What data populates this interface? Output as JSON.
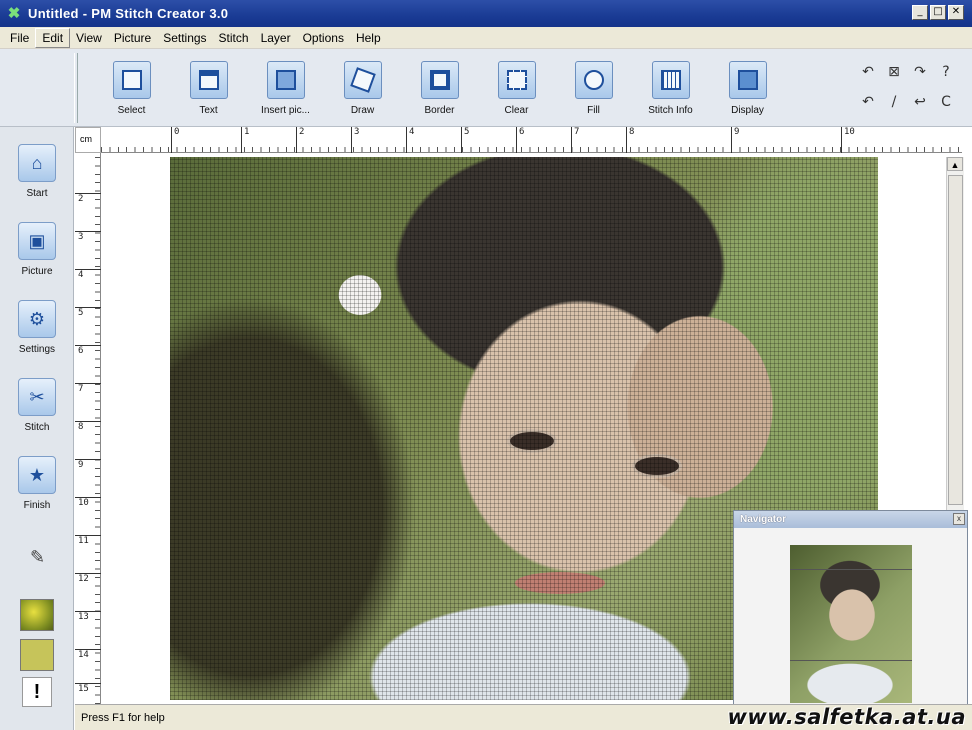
{
  "window": {
    "title": "Untitled - PM Stitch Creator 3.0",
    "controls": [
      "_",
      "□",
      "✕"
    ]
  },
  "menu": [
    "File",
    "Edit",
    "View",
    "Picture",
    "Settings",
    "Stitch",
    "Layer",
    "Options",
    "Help"
  ],
  "toolbar": {
    "tools": [
      {
        "label": "Select",
        "icon": "select-icon"
      },
      {
        "label": "Text",
        "icon": "text-icon"
      },
      {
        "label": "Insert pic...",
        "icon": "insert-picture-icon"
      },
      {
        "label": "Draw",
        "icon": "draw-icon"
      },
      {
        "label": "Border",
        "icon": "border-icon"
      },
      {
        "label": "Clear",
        "icon": "clear-icon"
      },
      {
        "label": "Fill",
        "icon": "fill-icon"
      },
      {
        "label": "Stitch Info",
        "icon": "stitch-info-icon"
      },
      {
        "label": "Display",
        "icon": "display-icon"
      }
    ],
    "mini_tools": [
      "↶",
      "⊠",
      "↷",
      "?",
      "↶",
      "/",
      "↩",
      "C"
    ]
  },
  "sidebar": {
    "items": [
      {
        "label": "Start",
        "glyph": "⌂"
      },
      {
        "label": "Picture",
        "glyph": "▣"
      },
      {
        "label": "Settings",
        "glyph": "⚙"
      },
      {
        "label": "Stitch",
        "glyph": "✂"
      },
      {
        "label": "Finish",
        "glyph": "★"
      }
    ],
    "pencil": "✎",
    "marker": "!"
  },
  "ruler": {
    "unit": "cm",
    "top": [
      "0",
      "1",
      "2",
      "3",
      "4",
      "5",
      "6",
      "7",
      "8",
      "9",
      "10"
    ],
    "left": [
      "2",
      "3",
      "4",
      "5",
      "6",
      "7",
      "8",
      "9",
      "10",
      "11",
      "12",
      "13",
      "14",
      "15"
    ]
  },
  "navigator": {
    "title": "Navigator",
    "close": "x"
  },
  "status": {
    "text": "Press F1 for help",
    "watermark": "www.salfetka.at.ua"
  },
  "colors": {
    "titlebar": "#1a3b94",
    "toolbar": "#e4e9f0",
    "sidebar": "#e1e6ec",
    "accent": "#1e4f9c"
  }
}
